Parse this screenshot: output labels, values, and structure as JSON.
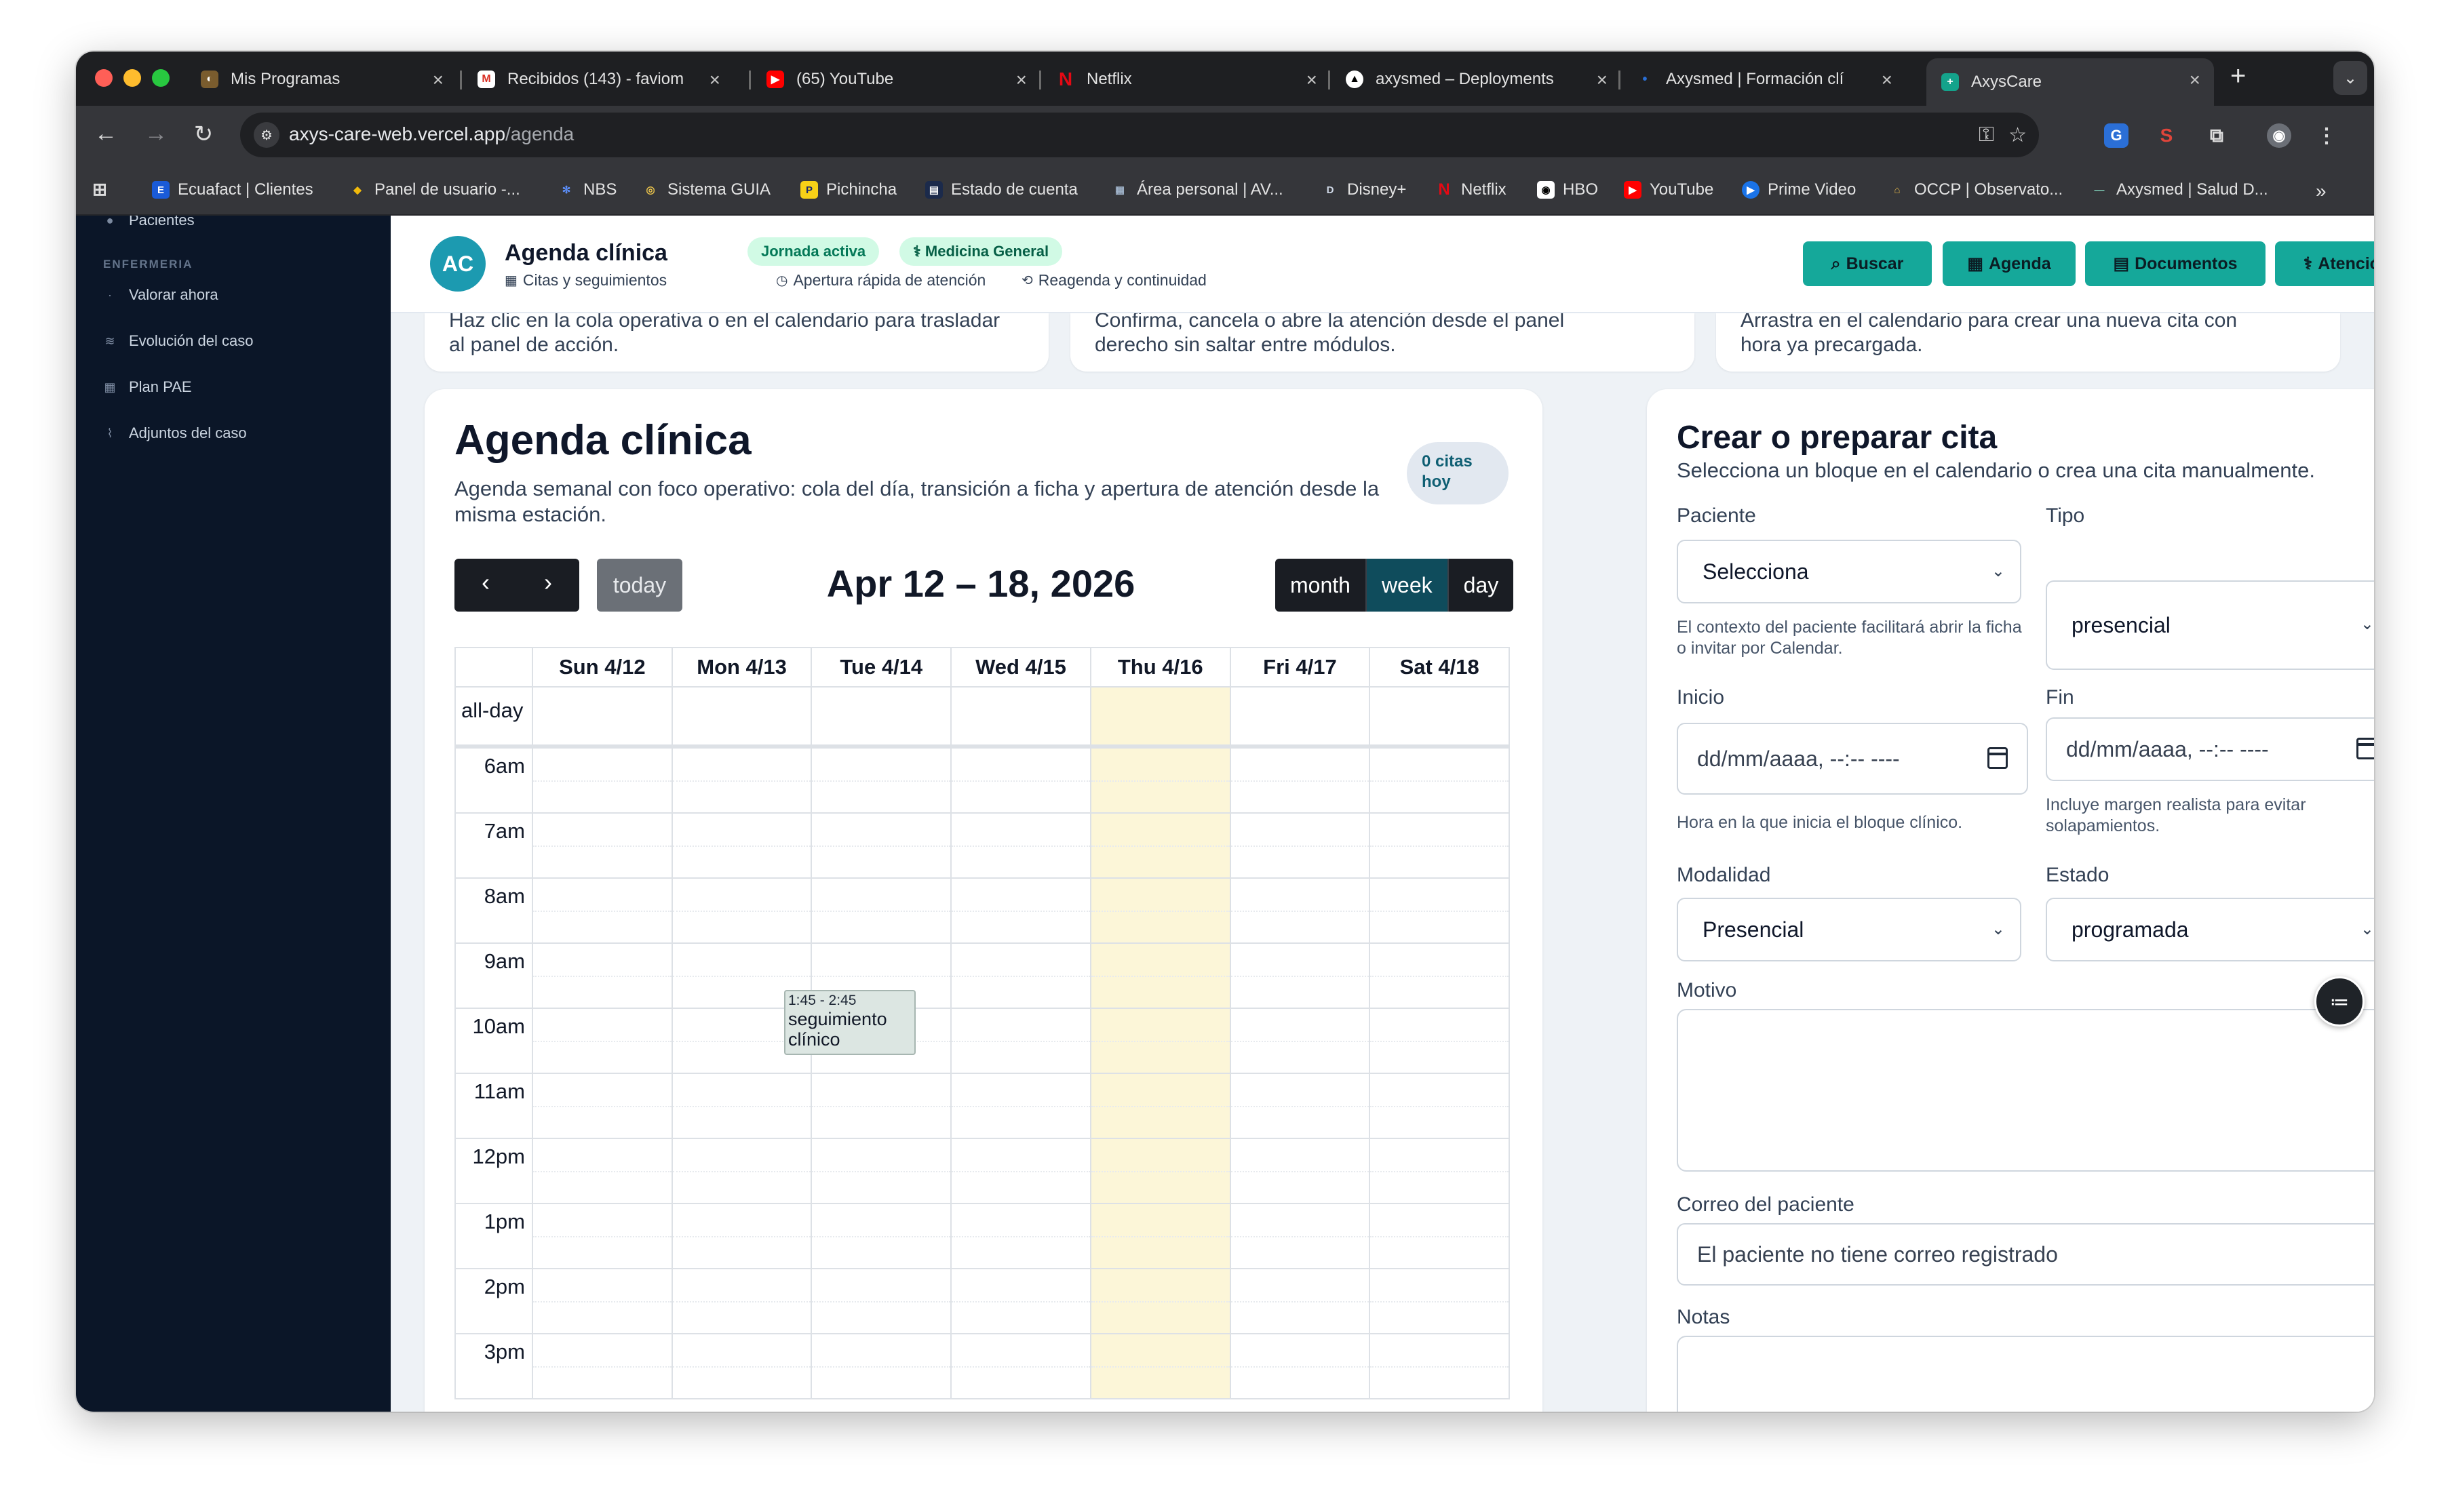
{
  "browser": {
    "tabs": [
      {
        "label": "Mis Programas",
        "icon": "program-icon",
        "color": "#7a5c2e"
      },
      {
        "label": "Recibidos (143) - faviom",
        "icon": "gmail-icon",
        "color": "#d93025"
      },
      {
        "label": "(65) YouTube",
        "icon": "youtube-icon",
        "color": "#ff0000"
      },
      {
        "label": "Netflix",
        "icon": "netflix-icon",
        "color": "#e50914"
      },
      {
        "label": "axysmed – Deployments",
        "icon": "vercel-icon",
        "color": "#000000"
      },
      {
        "label": "Axysmed | Formación clí",
        "icon": "axysmed-icon",
        "color": "#2a6fd6"
      },
      {
        "label": "AxysCare",
        "icon": "axyscare-icon",
        "color": "#14a38b"
      }
    ],
    "url_host": "axys-care-web.vercel.app",
    "url_path": "/agenda",
    "bookmarks": [
      "Ecuafact | Clientes",
      "Panel de usuario -...",
      "NBS",
      "Sistema GUIA",
      "Pichincha",
      "Estado de cuenta",
      "Área personal | AV...",
      "Disney+",
      "Netflix",
      "HBO",
      "YouTube",
      "Prime Video",
      "OCCP | Observato...",
      "Axysmed | Salud D..."
    ]
  },
  "sidebar": {
    "top_item": "Pacientes",
    "section": "ENFERMERIA",
    "items": [
      "Valorar ahora",
      "Evolución del caso",
      "Plan PAE",
      "Adjuntos del caso"
    ]
  },
  "header": {
    "avatar": "AC",
    "title": "Agenda clínica",
    "badge_status": "Jornada activa",
    "badge_specialty": "Medicina General",
    "sub1": "Citas y seguimientos",
    "sub2": "Apertura rápida de atención",
    "sub3": "Reagenda y continuidad",
    "buttons": [
      "Buscar",
      "Agenda",
      "Documentos",
      "Atención"
    ]
  },
  "info_cards": [
    {
      "cut": "Haz clic en la cola operativa o en el calendario para trasladar",
      "text": "al panel de acción."
    },
    {
      "cut": "Confirma, cancela o abre la atención desde el panel",
      "text": "derecho sin saltar entre módulos."
    },
    {
      "cut": "Arrastra en el calendario para crear una nueva cita con",
      "text": "hora ya precargada."
    }
  ],
  "agenda": {
    "title": "Agenda clínica",
    "description": "Agenda semanal con foco operativo: cola del día, transición a ficha y apertura de atención desde la misma estación.",
    "citas_count": "0 citas",
    "citas_suffix": "hoy",
    "today_label": "today",
    "range_title": "Apr 12 – 18, 2026",
    "views": [
      "month",
      "week",
      "day"
    ],
    "active_view": "week",
    "days": [
      "Sun 4/12",
      "Mon 4/13",
      "Tue 4/14",
      "Wed 4/15",
      "Thu 4/16",
      "Fri 4/17",
      "Sat 4/18"
    ],
    "today_index": 4,
    "all_day_label": "all-day",
    "hours": [
      "6am",
      "7am",
      "8am",
      "9am",
      "10am",
      "11am",
      "12pm",
      "1pm",
      "2pm",
      "3pm"
    ],
    "event": {
      "time": "1:45 - 2:45",
      "title": "seguimiento clínico",
      "day_index": 2
    }
  },
  "form": {
    "title": "Crear o preparar cita",
    "subtitle": "Selecciona un bloque en el calendario o crea una cita manualmente.",
    "paciente_label": "Paciente",
    "paciente_value": "Selecciona",
    "paciente_help": "El contexto del paciente facilitará abrir la ficha o invitar por Calendar.",
    "tipo_label": "Tipo",
    "tipo_value": "presencial",
    "inicio_label": "Inicio",
    "inicio_placeholder": "dd/mm/aaaa, --:-- ----",
    "inicio_help": "Hora en la que inicia el bloque clínico.",
    "fin_label": "Fin",
    "fin_placeholder": "dd/mm/aaaa, --:-- ----",
    "fin_help": "Incluye margen realista para evitar solapamientos.",
    "modalidad_label": "Modalidad",
    "modalidad_value": "Presencial",
    "estado_label": "Estado",
    "estado_value": "programada",
    "motivo_label": "Motivo",
    "correo_label": "Correo del paciente",
    "correo_placeholder": "El paciente no tiene correo registrado",
    "notas_label": "Notas"
  },
  "colors": {
    "accent": "#15a89a",
    "sidebar_bg": "#0b1628",
    "today_bg": "#fcf6d8",
    "calendar_dark": "#1a1d23",
    "active_view": "#0f4c5c"
  }
}
